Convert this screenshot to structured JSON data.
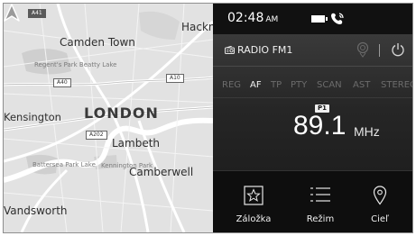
{
  "map": {
    "labels": {
      "camden": "Camden Town",
      "hackney": "Hackne",
      "kensington": "Kensington",
      "london": "LONDON",
      "lambeth": "Lambeth",
      "camberwell": "Camberwell",
      "wandsworth": "Vandsworth",
      "park1": "Regent's Park Beatty Lake",
      "park2": "Battersea Park Lake",
      "park3": "Kennington Park"
    },
    "shields": {
      "a41": "A41",
      "a40": "A40",
      "a10": "A10",
      "a202": "A202"
    }
  },
  "status": {
    "time": "02:48",
    "ampm": "AM",
    "icons": [
      "battery-icon",
      "phone-icon"
    ]
  },
  "radio": {
    "station": "RADIO FM1",
    "modes": [
      "REG",
      "AF",
      "TP",
      "PTY",
      "SCAN",
      "AST",
      "STEREO"
    ],
    "active_mode": "AF",
    "preset": "P1",
    "frequency": "89.1",
    "unit": "MHz"
  },
  "bottom": {
    "bookmark_label": "Záložka",
    "mode_label": "Režim",
    "destination_label": "Cieľ"
  }
}
